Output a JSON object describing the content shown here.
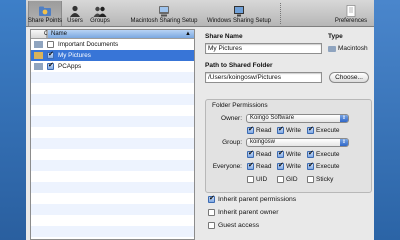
{
  "toolbar": {
    "items": [
      {
        "label": "Share Points",
        "icon": "share-points-icon",
        "active": true
      },
      {
        "label": "Users",
        "icon": "users-icon"
      },
      {
        "label": "Groups",
        "icon": "groups-icon"
      },
      {
        "label": "Macintosh Sharing Setup",
        "icon": "macintosh-sharing-icon"
      },
      {
        "label": "Windows Sharing Setup",
        "icon": "windows-sharing-icon"
      },
      {
        "label": "Preferences",
        "icon": "preferences-icon"
      }
    ]
  },
  "list": {
    "col_on": "On",
    "col_name": "Name",
    "rows": [
      {
        "name": "Important Documents",
        "on": false,
        "selected": false
      },
      {
        "name": "My Pictures",
        "on": true,
        "selected": true
      },
      {
        "name": "PCApps",
        "on": true,
        "selected": false
      }
    ]
  },
  "share": {
    "share_name_label": "Share Name",
    "share_name_value": "My Pictures",
    "type_label": "Type",
    "type_value": "Macintosh",
    "path_label": "Path to Shared Folder",
    "path_value": "/Users/koingosw/Pictures",
    "choose_button": "Choose..."
  },
  "permissions": {
    "title": "Folder Permissions",
    "owner_label": "Owner:",
    "owner_value": "Koingo Software",
    "group_label": "Group:",
    "group_value": "koingosw",
    "everyone_label": "Everyone:",
    "read": "Read",
    "write": "Write",
    "execute": "Execute",
    "uid": "UID",
    "gid": "GID",
    "sticky": "Sticky"
  },
  "options": {
    "inherit_permissions": "Inherit parent permissions",
    "inherit_owner": "Inherit parent owner",
    "guest_access": "Guest access"
  },
  "colors": {
    "selection": "#3875d7",
    "desktop": "#2f6fb8"
  }
}
